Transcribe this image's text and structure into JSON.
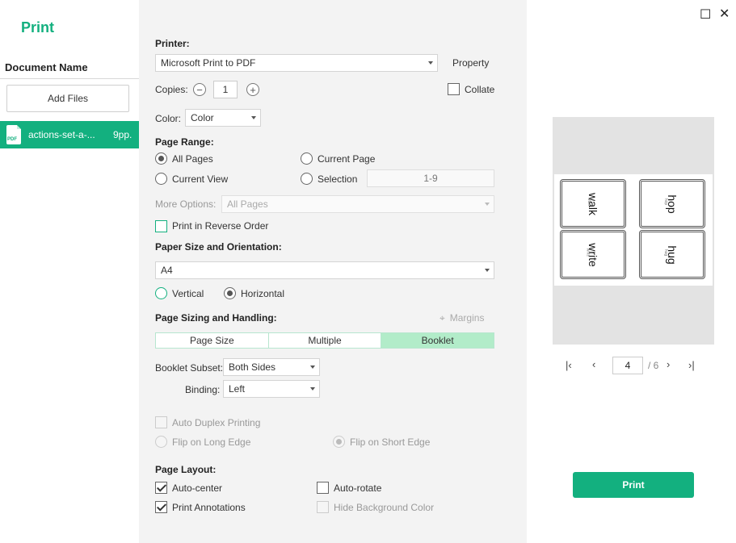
{
  "sidebar": {
    "title": "Print",
    "document_name_label": "Document Name",
    "add_files_label": "Add Files",
    "files": [
      {
        "name": "actions-set-a-...",
        "pages": "9pp."
      }
    ]
  },
  "settings": {
    "printer_label": "Printer:",
    "printer_value": "Microsoft Print to PDF",
    "property_label": "Property",
    "copies_label": "Copies:",
    "copies_value": "1",
    "collate_label": "Collate",
    "color_label": "Color:",
    "color_value": "Color",
    "page_range_label": "Page Range:",
    "all_pages_label": "All Pages",
    "current_page_label": "Current Page",
    "current_view_label": "Current View",
    "selection_label": "Selection",
    "range_value": "1-9",
    "more_options_label": "More Options:",
    "more_options_value": "All Pages",
    "reverse_order_label": "Print in Reverse Order",
    "paper_label": "Paper Size and Orientation:",
    "paper_value": "A4",
    "vertical_label": "Vertical",
    "horizontal_label": "Horizontal",
    "sizing_label": "Page Sizing and Handling:",
    "margins_label": "Margins",
    "sizing_tabs": [
      "Page Size",
      "Multiple",
      "Booklet"
    ],
    "booklet_subset_label": "Booklet Subset:",
    "booklet_subset_value": "Both Sides",
    "binding_label": "Binding:",
    "binding_value": "Left",
    "auto_duplex_label": "Auto Duplex Printing",
    "flip_long_label": "Flip on Long Edge",
    "flip_short_label": "Flip on Short Edge",
    "page_layout_label": "Page Layout:",
    "auto_center_label": "Auto-center",
    "auto_rotate_label": "Auto-rotate",
    "print_annotations_label": "Print Annotations",
    "hide_bg_label": "Hide Background Color"
  },
  "preview": {
    "cards": [
      {
        "word": "walk",
        "small": "walk"
      },
      {
        "word": "hop",
        "small": "hop"
      },
      {
        "word": "write",
        "small": "write"
      },
      {
        "word": "hug",
        "small": "hug"
      }
    ],
    "current_page": "4",
    "total_pages": "/ 6",
    "print_label": "Print"
  },
  "colors": {
    "accent": "#13b07f",
    "panel_bg": "#f3f3f3",
    "tab_active": "#b2ecc9"
  }
}
